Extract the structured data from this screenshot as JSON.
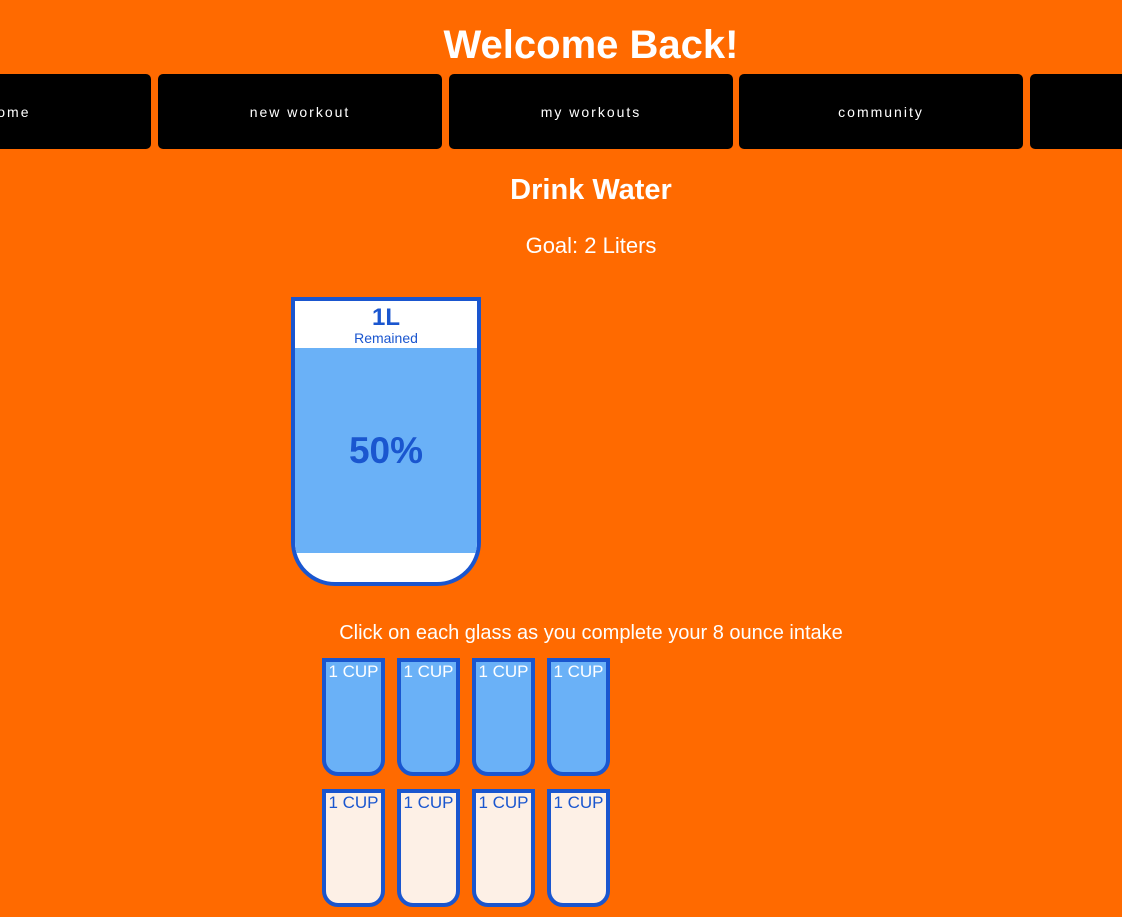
{
  "header": {
    "title": "Welcome Back!"
  },
  "nav": {
    "items": [
      {
        "label": "home"
      },
      {
        "label": "new workout"
      },
      {
        "label": "my workouts"
      },
      {
        "label": "community"
      },
      {
        "label": ""
      }
    ]
  },
  "tracker": {
    "title": "Drink Water",
    "goal": "Goal: 2 Liters",
    "remaining_amount": "1L",
    "remaining_label": "Remained",
    "percent_label": "50%",
    "percent_complete": 50,
    "instruction": "Click on each glass as you complete your 8 ounce intake",
    "cups": [
      {
        "label": "1 CUP",
        "filled": true
      },
      {
        "label": "1 CUP",
        "filled": true
      },
      {
        "label": "1 CUP",
        "filled": true
      },
      {
        "label": "1 CUP",
        "filled": true
      },
      {
        "label": "1 CUP",
        "filled": false
      },
      {
        "label": "1 CUP",
        "filled": false
      },
      {
        "label": "1 CUP",
        "filled": false
      },
      {
        "label": "1 CUP",
        "filled": false
      }
    ]
  },
  "colors": {
    "background": "#ff6a00",
    "nav_background": "#000000",
    "water": "#6ab1f7",
    "glass_border": "#1a56cf",
    "empty_cup": "#fdf0e6"
  }
}
